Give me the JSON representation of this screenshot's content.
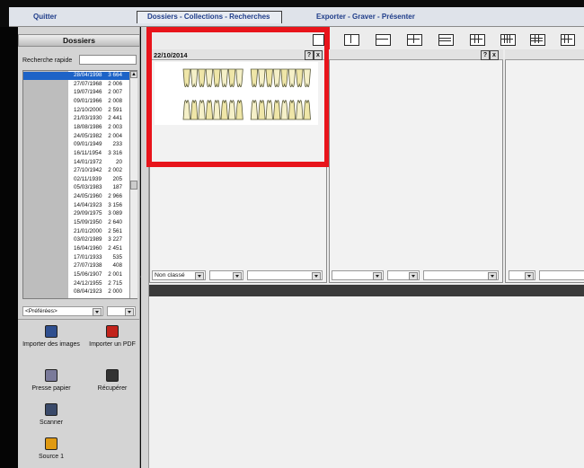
{
  "menu": {
    "quit": "Quitter",
    "dossiers_tab": "Dossiers - Collections - Recherches",
    "export": "Exporter - Graver - Présenter"
  },
  "sidebar": {
    "title": "Dossiers",
    "search_label": "Recherche rapide",
    "rows": [
      {
        "mark": "",
        "date": "28/04/1998",
        "num": "3 664",
        "selected": true
      },
      {
        "mark": "",
        "date": "27/07/1968",
        "num": "2 006"
      },
      {
        "mark": "",
        "date": "19/07/1946",
        "num": "2 007"
      },
      {
        "mark": "",
        "date": "09/01/1966",
        "num": "2 008"
      },
      {
        "mark": "",
        "date": "12/10/2000",
        "num": "2 591"
      },
      {
        "mark": "",
        "date": "21/03/1930",
        "num": "2 441"
      },
      {
        "mark": "",
        "date": "18/08/1986",
        "num": "2 003"
      },
      {
        "mark": "",
        "date": "24/05/1982",
        "num": "2 004"
      },
      {
        "mark": "",
        "date": "09/01/1949",
        "num": "233"
      },
      {
        "mark": "",
        "date": "16/11/1954",
        "num": "3 316"
      },
      {
        "mark": "",
        "date": "14/01/1972",
        "num": "20"
      },
      {
        "mark": "",
        "date": "27/10/1942",
        "num": "2 002"
      },
      {
        "mark": "",
        "date": "02/11/1939",
        "num": "205"
      },
      {
        "mark": "",
        "date": "05/03/1983",
        "num": "187"
      },
      {
        "mark": "",
        "date": "24/05/1960",
        "num": "2 966"
      },
      {
        "mark": "",
        "date": "14/04/1923",
        "num": "3 156"
      },
      {
        "mark": "",
        "date": "29/09/1975",
        "num": "3 089"
      },
      {
        "mark": "",
        "date": "15/09/1950",
        "num": "2 640"
      },
      {
        "mark": "",
        "date": "21/01/2000",
        "num": "2 561"
      },
      {
        "mark": "",
        "date": "03/02/1989",
        "num": "3 227"
      },
      {
        "mark": "",
        "date": "16/04/1960",
        "num": "2 451"
      },
      {
        "mark": "",
        "date": "17/01/1933",
        "num": "535"
      },
      {
        "mark": "",
        "date": "27/07/1938",
        "num": "408"
      },
      {
        "mark": "",
        "date": "15/06/1907",
        "num": "2 001"
      },
      {
        "mark": "",
        "date": "24/12/1955",
        "num": "2 715"
      },
      {
        "mark": "",
        "date": "08/04/1923",
        "num": "2 000"
      }
    ],
    "preferences_label": "<Préférées>",
    "tools": [
      {
        "label": "Importer des images",
        "icon": "floppy-disk-icon"
      },
      {
        "label": "Importer un PDF",
        "icon": "pdf-icon"
      },
      {
        "label": "Presse papier",
        "icon": "clipboard-icon"
      },
      {
        "label": "Récupérer",
        "icon": "recover-icon"
      },
      {
        "label": "Scanner",
        "icon": "scanner-icon"
      },
      {
        "label": "Source 1",
        "icon": "camera-icon"
      }
    ]
  },
  "panels": [
    {
      "date": "22/10/2014",
      "help": "?",
      "close": "x",
      "classification": "Non classé"
    },
    {
      "date": "",
      "help": "?",
      "close": "x",
      "classification": ""
    }
  ],
  "colors": {
    "highlight": "#e8141b",
    "selection": "#1d63c7",
    "header_bar": "#3a3a3a"
  }
}
